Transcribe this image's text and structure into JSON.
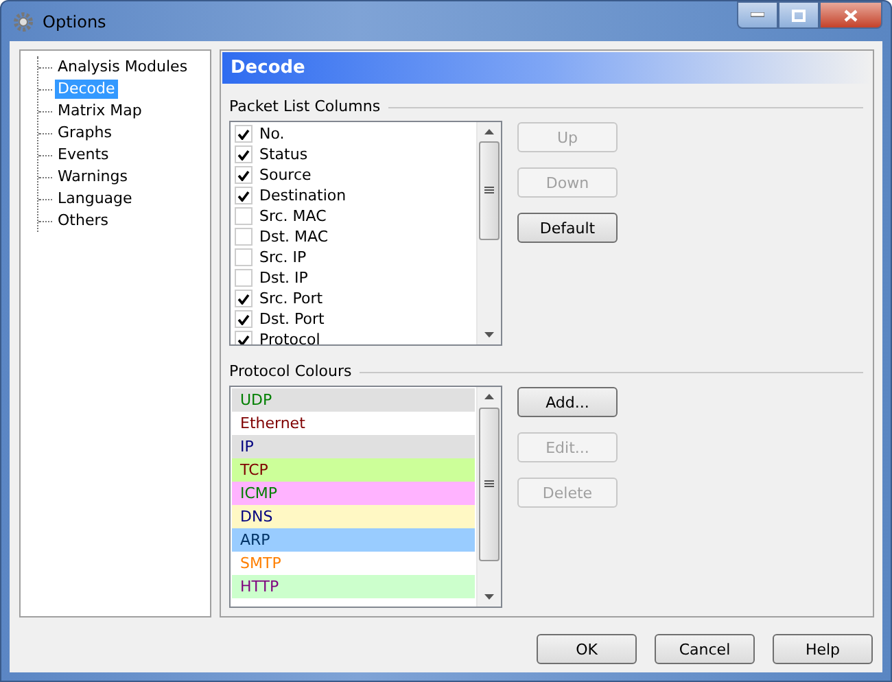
{
  "window": {
    "title": "Options"
  },
  "sidebar": {
    "items": [
      {
        "label": "Analysis Modules",
        "selected": false
      },
      {
        "label": "Decode",
        "selected": true
      },
      {
        "label": "Matrix Map",
        "selected": false
      },
      {
        "label": "Graphs",
        "selected": false
      },
      {
        "label": "Events",
        "selected": false
      },
      {
        "label": "Warnings",
        "selected": false
      },
      {
        "label": "Language",
        "selected": false
      },
      {
        "label": "Others",
        "selected": false
      }
    ]
  },
  "panel": {
    "title": "Decode"
  },
  "packet_list_columns": {
    "label": "Packet List Columns",
    "items": [
      {
        "label": "No.",
        "checked": true
      },
      {
        "label": "Status",
        "checked": true
      },
      {
        "label": "Source",
        "checked": true
      },
      {
        "label": "Destination",
        "checked": true
      },
      {
        "label": "Src. MAC",
        "checked": false
      },
      {
        "label": "Dst. MAC",
        "checked": false
      },
      {
        "label": "Src. IP",
        "checked": false
      },
      {
        "label": "Dst. IP",
        "checked": false
      },
      {
        "label": "Src. Port",
        "checked": true
      },
      {
        "label": "Dst. Port",
        "checked": true
      },
      {
        "label": "Protocol",
        "checked": true
      }
    ],
    "buttons": [
      {
        "label": "Up",
        "disabled": true
      },
      {
        "label": "Down",
        "disabled": true
      },
      {
        "label": "Default",
        "disabled": false
      }
    ]
  },
  "protocol_colours": {
    "label": "Protocol Colours",
    "items": [
      {
        "label": "UDP",
        "color": "#e0e0e0",
        "text": {
          "color": "#007f00"
        }
      },
      {
        "label": "Ethernet",
        "color": "#ffffff",
        "text": {
          "color": "#7f0000"
        }
      },
      {
        "label": "IP",
        "color": "#e0e0e0",
        "text": {
          "color": "#00007f"
        }
      },
      {
        "label": "TCP",
        "color": "#ccff99",
        "text": {
          "color": "#7f0000"
        }
      },
      {
        "label": "ICMP",
        "color": "#ffb3ff",
        "text": {
          "color": "#007f00"
        }
      },
      {
        "label": "DNS",
        "color": "#fff8c4",
        "text": {
          "color": "#00007f"
        }
      },
      {
        "label": "ARP",
        "color": "#99ccff",
        "text": {
          "color": "#003366"
        }
      },
      {
        "label": "SMTP",
        "color": "#ffffff",
        "text": {
          "color": "#ff7f00"
        }
      },
      {
        "label": "HTTP",
        "color": "#ccffcc",
        "text": {
          "color": "#7f007f"
        }
      }
    ],
    "buttons": [
      {
        "label": "Add...",
        "disabled": false
      },
      {
        "label": "Edit...",
        "disabled": true
      },
      {
        "label": "Delete",
        "disabled": true
      }
    ]
  },
  "buttons": [
    {
      "label": "OK"
    },
    {
      "label": "Cancel"
    },
    {
      "label": "Help"
    }
  ]
}
